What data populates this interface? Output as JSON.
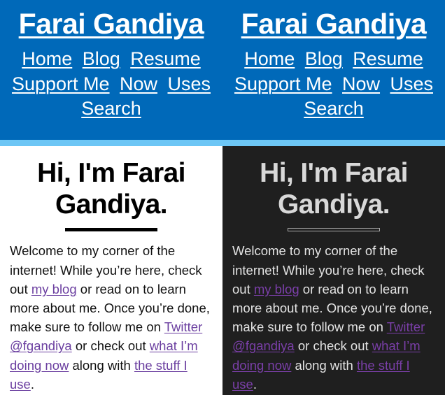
{
  "header": {
    "site_title": "Farai Gandiya",
    "nav_items": [
      {
        "label": "Home"
      },
      {
        "label": "Blog"
      },
      {
        "label": "Resume"
      },
      {
        "label": "Support Me"
      },
      {
        "label": "Now"
      },
      {
        "label": "Uses"
      },
      {
        "label": "Search"
      }
    ],
    "background_color": "#0069b9",
    "accent_strip_color": "#6dc6f5",
    "link_color": "#ffffff"
  },
  "hero": {
    "title": "Hi, I'm Farai Gandiya.",
    "body_segments": [
      {
        "type": "text",
        "text": "Welcome to my corner of the internet! While you’re here, check out "
      },
      {
        "type": "link",
        "text": "my blog"
      },
      {
        "type": "text",
        "text": " or read on to learn more about me. Once you’re done, make sure to follow me on "
      },
      {
        "type": "link",
        "text": "Twitter @fgandiya"
      },
      {
        "type": "text",
        "text": " or check out "
      },
      {
        "type": "link",
        "text": "what I’m doing now"
      },
      {
        "type": "text",
        "text": " along with "
      },
      {
        "type": "link",
        "text": "the stuff I use"
      },
      {
        "type": "text",
        "text": "."
      }
    ]
  },
  "panes": [
    {
      "theme": "light",
      "background_color": "#ffffff",
      "text_color": "#111111",
      "heading_color": "#000000",
      "link_color": "#6b3fa0",
      "rule_style": "solid"
    },
    {
      "theme": "dark",
      "background_color": "#1f1f1f",
      "text_color": "#e2e2e2",
      "heading_color": "#d8d8d8",
      "link_color": "#7a3fa8",
      "rule_style": "outline"
    }
  ]
}
